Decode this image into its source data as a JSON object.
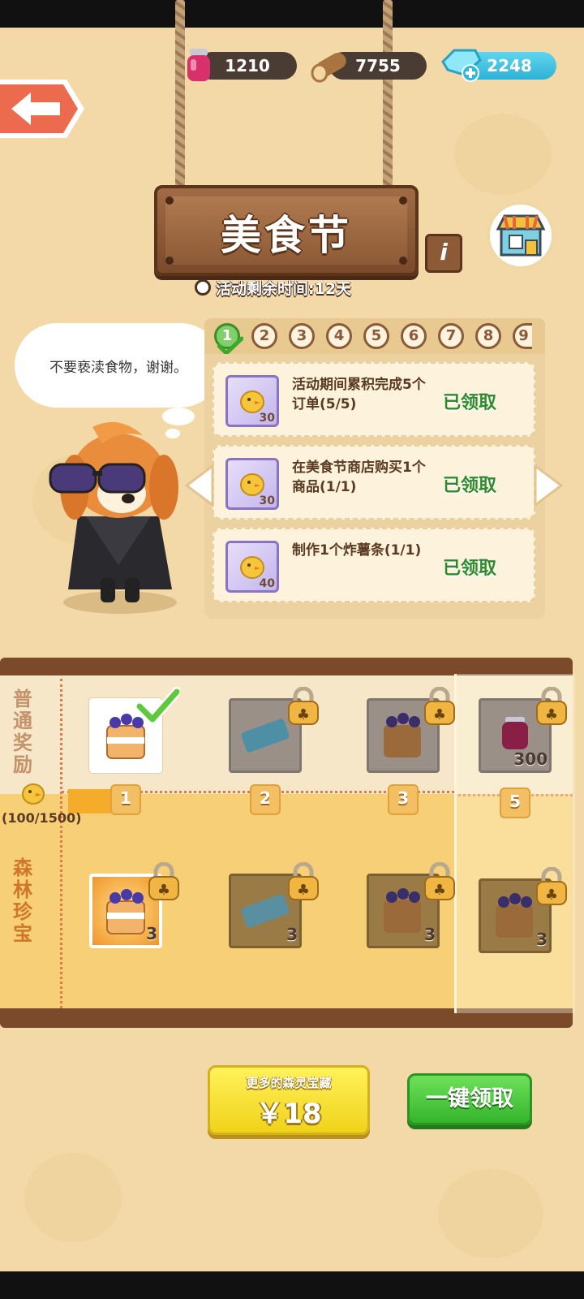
{
  "resources": {
    "jam": "1210",
    "wood": "7755",
    "gems": "2248"
  },
  "event": {
    "title": "美食节",
    "timer": "活动剩余时间:12天",
    "info_label": "i"
  },
  "npc": {
    "speech": "不要亵渎食物，谢谢。"
  },
  "task_tabs": [
    "1",
    "2",
    "3",
    "4",
    "5",
    "6",
    "7",
    "8",
    "9"
  ],
  "tasks": [
    {
      "desc": "活动期间累积完成5个订单(5/5)",
      "reward": "30",
      "status": "已领取"
    },
    {
      "desc": "在美食节商店购买1个商品(1/1)",
      "reward": "30",
      "status": "已领取"
    },
    {
      "desc": "制作1个炸薯条(1/1)",
      "reward": "40",
      "status": "已领取"
    }
  ],
  "track": {
    "normal_label": "普通奖励",
    "premium_label": "森林珍宝",
    "progress_text": "(100/1500)",
    "progress": {
      "current": 100,
      "max": 1500
    },
    "levels": [
      "1",
      "2",
      "3",
      "5"
    ],
    "normal_rewards": [
      {
        "icon": "cake-icon",
        "qty": "",
        "claimed": true,
        "locked": false
      },
      {
        "icon": "ticket-icon",
        "qty": "",
        "claimed": false,
        "locked": true
      },
      {
        "icon": "cake-icon",
        "qty": "",
        "claimed": false,
        "locked": true
      },
      {
        "icon": "jam-jar-icon",
        "qty": "300",
        "claimed": false,
        "locked": true
      }
    ],
    "premium_rewards": [
      {
        "icon": "cake-icon",
        "qty": "3",
        "locked": true
      },
      {
        "icon": "ticket-icon",
        "qty": "3",
        "locked": true
      },
      {
        "icon": "cake-icon",
        "qty": "3",
        "locked": true
      },
      {
        "icon": "cake-icon",
        "qty": "3",
        "locked": true
      }
    ]
  },
  "buttons": {
    "buy_sub": "更多的森灵宝藏",
    "buy_price": "￥18",
    "claim_all": "一键领取"
  },
  "colors": {
    "background": "#f3d9a7",
    "wood": "#7a4a2b",
    "claimed_green": "#2e8a2f",
    "buy_yellow": "#f0d21a",
    "claim_green": "#35b52c"
  }
}
